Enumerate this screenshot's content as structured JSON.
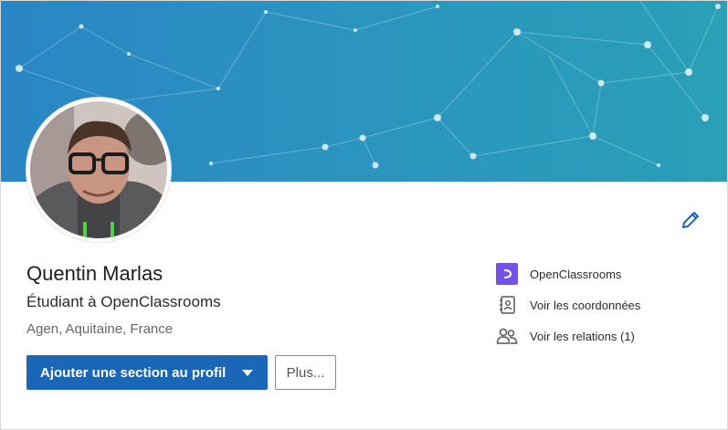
{
  "profile": {
    "name": "Quentin Marlas",
    "headline": "Étudiant à OpenClassrooms",
    "location": "Agen, Aquitaine, France"
  },
  "actions": {
    "add_section_label": "Ajouter une section au profil",
    "more_label": "Plus..."
  },
  "sidebar": {
    "items": [
      {
        "label": "OpenClassrooms",
        "icon": "openclassrooms-logo-icon"
      },
      {
        "label": "Voir les coordonnées",
        "icon": "contact-card-icon"
      },
      {
        "label": "Voir les relations (1)",
        "icon": "connections-icon"
      }
    ]
  },
  "colors": {
    "banner_start": "#2a86c4",
    "banner_end": "#2aa0b6",
    "primary": "#1a67b8",
    "openclassrooms": "#7451eb",
    "edit_icon": "#1a67b8"
  },
  "icons": {
    "edit": "pencil-icon",
    "dropdown": "caret-down-icon"
  }
}
